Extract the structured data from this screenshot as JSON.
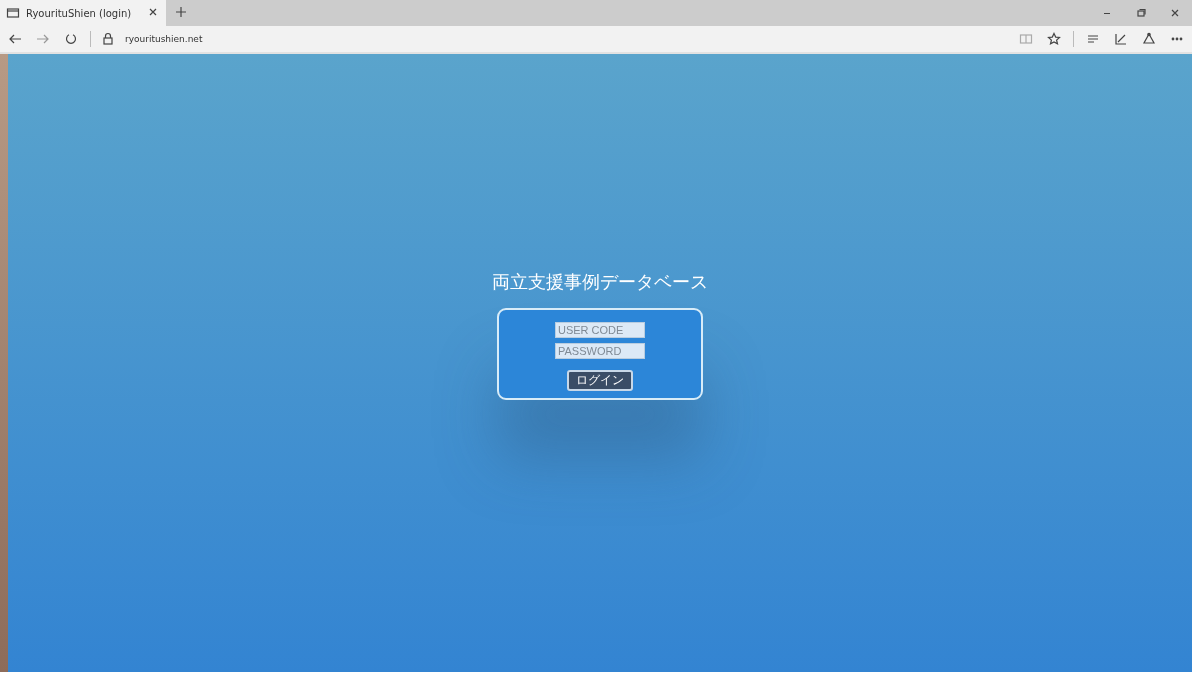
{
  "tab": {
    "title": "RyourituShien (login)",
    "selected": true
  },
  "address_bar": {
    "url": "ryouritushien.net"
  },
  "page": {
    "heading": "両立支援事例データベース",
    "user_code": {
      "placeholder": "USER CODE"
    },
    "password": {
      "placeholder": "PASSWORD"
    },
    "login_button": "ログイン"
  }
}
